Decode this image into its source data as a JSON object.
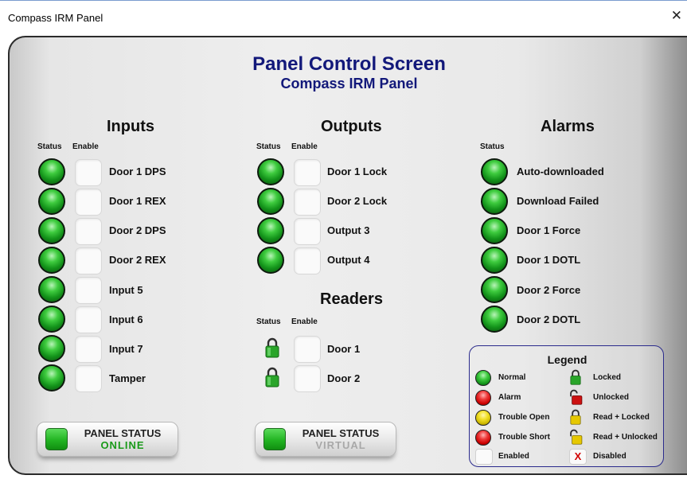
{
  "window": {
    "title": "Compass IRM Panel",
    "close_glyph": "✕"
  },
  "header": {
    "title": "Panel Control Screen",
    "subtitle": "Compass IRM Panel"
  },
  "inputs": {
    "title": "Inputs",
    "status_head": "Status",
    "enable_head": "Enable",
    "items": [
      {
        "label": "Door 1 DPS",
        "status": "normal"
      },
      {
        "label": "Door 1 REX",
        "status": "normal"
      },
      {
        "label": "Door 2 DPS",
        "status": "normal"
      },
      {
        "label": "Door 2 REX",
        "status": "normal"
      },
      {
        "label": "Input 5",
        "status": "normal"
      },
      {
        "label": "Input 6",
        "status": "normal"
      },
      {
        "label": "Input 7",
        "status": "normal"
      },
      {
        "label": "Tamper",
        "status": "normal"
      }
    ]
  },
  "outputs": {
    "title": "Outputs",
    "status_head": "Status",
    "enable_head": "Enable",
    "items": [
      {
        "label": "Door 1 Lock",
        "status": "normal"
      },
      {
        "label": "Door 2 Lock",
        "status": "normal"
      },
      {
        "label": "Output 3",
        "status": "normal"
      },
      {
        "label": "Output 4",
        "status": "normal"
      }
    ]
  },
  "readers": {
    "title": "Readers",
    "status_head": "Status",
    "enable_head": "Enable",
    "items": [
      {
        "label": "Door 1",
        "status": "locked"
      },
      {
        "label": "Door 2",
        "status": "locked"
      }
    ]
  },
  "alarms": {
    "title": "Alarms",
    "status_head": "Status",
    "items": [
      {
        "label": "Auto-downloaded",
        "status": "normal"
      },
      {
        "label": "Download Failed",
        "status": "normal"
      },
      {
        "label": "Door 1 Force",
        "status": "normal"
      },
      {
        "label": "Door 1 DOTL",
        "status": "normal"
      },
      {
        "label": "Door 2 Force",
        "status": "normal"
      },
      {
        "label": "Door 2 DOTL",
        "status": "normal"
      }
    ]
  },
  "panel_status_online": {
    "line1": "PANEL STATUS",
    "line2": "ONLINE",
    "color": "#1a9a1a"
  },
  "panel_status_virtual": {
    "line1": "PANEL STATUS",
    "line2": "VIRTUAL",
    "color": "#a8a8a8"
  },
  "legend": {
    "title": "Legend",
    "normal": "Normal",
    "alarm": "Alarm",
    "trouble_open": "Trouble Open",
    "trouble_short": "Trouble Short",
    "enabled": "Enabled",
    "locked": "Locked",
    "unlocked": "Unlocked",
    "read_locked": "Read + Locked",
    "read_unlocked": "Read + Unlocked",
    "disabled": "Disabled",
    "disabled_mark": "X"
  },
  "colors": {
    "title_navy": "#12187a",
    "led_green": "#13931a",
    "alarm_red": "#d01010",
    "trouble_yellow": "#e8d800",
    "lock_green": "#2aa52a",
    "lock_red": "#cc1111",
    "lock_yellow": "#e6c800"
  }
}
